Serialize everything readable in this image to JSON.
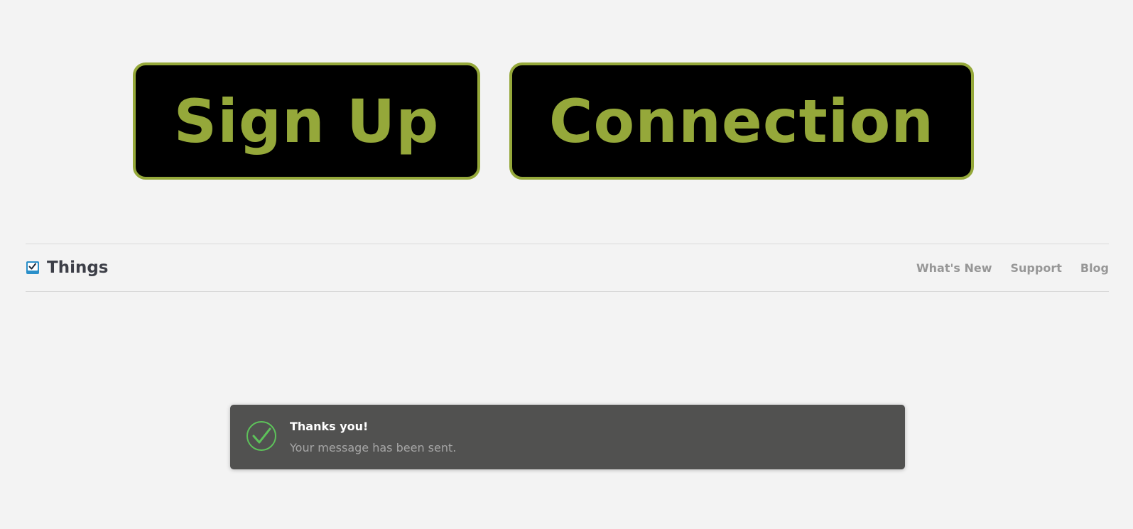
{
  "buttons": {
    "signup_label": "Sign Up",
    "connection_label": "Connection"
  },
  "navbar": {
    "brand_icon": "checkbox-icon",
    "brand_name": "Things",
    "links": [
      "What's New",
      "Support",
      "Blog"
    ]
  },
  "toast": {
    "icon": "check-circle-icon",
    "title": "Thanks you!",
    "message": "Your message has been sent."
  },
  "colors": {
    "background": "#f3f3f3",
    "accent_green": "#95a83a",
    "button_bg": "#000000",
    "toast_bg": "#515150",
    "success_green": "#5dc25a",
    "brand_icon_blue": "#2a8fc9"
  }
}
